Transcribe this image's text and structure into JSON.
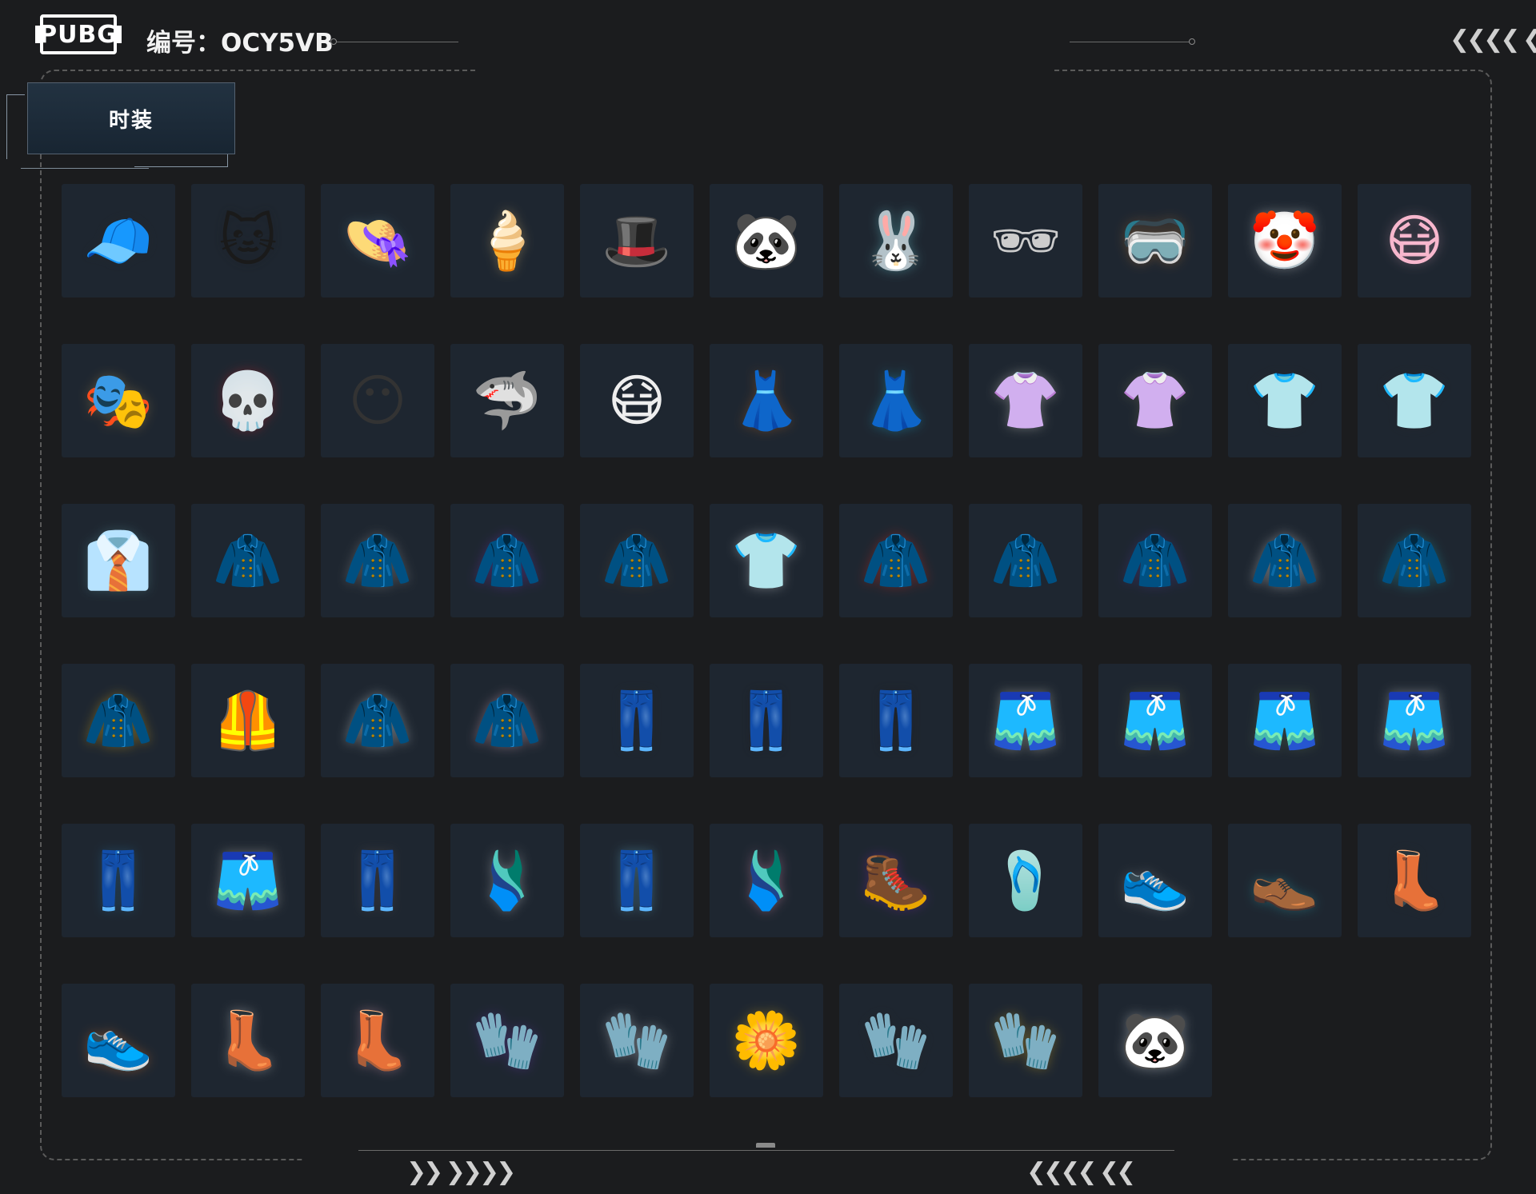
{
  "header": {
    "logo_text": "PUBG",
    "serial_label": "编号：",
    "serial_value": "OCY5VB",
    "chevrons_right": "❮❮❮❮ ❮"
  },
  "tab": {
    "label": "时装"
  },
  "footer": {
    "chevrons_left": "❯❯ ❯❯❯❯",
    "chevrons_right": "❮❮❮❮ ❮❮"
  },
  "items": [
    {
      "icon": "black-baseball-cap-icon",
      "glyph": "🧢",
      "color": "#2b2b2b"
    },
    {
      "icon": "black-cat-beanie-icon",
      "glyph": "🐱",
      "color": "#1a1a1a"
    },
    {
      "icon": "bucket-hat-icon",
      "glyph": "👒",
      "color": "#5a7f8f"
    },
    {
      "icon": "ice-cream-cone-hat-icon",
      "glyph": "🍦",
      "color": "#e8c17a"
    },
    {
      "icon": "black-wide-hat-icon",
      "glyph": "🎩",
      "color": "#222"
    },
    {
      "icon": "panda-headband-icon",
      "glyph": "🐼",
      "color": "#eee"
    },
    {
      "icon": "bunny-ears-headband-icon",
      "glyph": "🐰",
      "color": "#7fe0e6"
    },
    {
      "icon": "sunglasses-icon",
      "glyph": "🕶",
      "color": "#ccc"
    },
    {
      "icon": "orange-visor-icon",
      "glyph": "🥽",
      "color": "#c77d35"
    },
    {
      "icon": "clown-mask-goggles-icon",
      "glyph": "🤡",
      "color": "#eaeaea"
    },
    {
      "icon": "pink-face-mask-icon",
      "glyph": "😷",
      "color": "#f3b8cc"
    },
    {
      "icon": "gold-horned-mask-icon",
      "glyph": "🎭",
      "color": "#b99a55"
    },
    {
      "icon": "red-skull-mask-icon",
      "glyph": "💀",
      "color": "#c0282d"
    },
    {
      "icon": "black-tactical-mask-icon",
      "glyph": "😶",
      "color": "#333"
    },
    {
      "icon": "shark-teeth-mask-icon",
      "glyph": "🦈",
      "color": "#111"
    },
    {
      "icon": "white-face-mask-icon",
      "glyph": "😷",
      "color": "#eee"
    },
    {
      "icon": "orange-tie-dye-romper-icon",
      "glyph": "👗",
      "color": "#b46a2c"
    },
    {
      "icon": "blue-tie-dye-dress-icon",
      "glyph": "👗",
      "color": "#2ab3d6"
    },
    {
      "icon": "white-tie-front-shirt-icon",
      "glyph": "👚",
      "color": "#e9e6dc"
    },
    {
      "icon": "floral-tie-front-shirt-icon",
      "glyph": "👚",
      "color": "#7d7f5f"
    },
    {
      "icon": "black-long-sleeve-shirt-icon",
      "glyph": "👕",
      "color": "#2d2d2d"
    },
    {
      "icon": "black-chick-tshirt-icon",
      "glyph": "👕",
      "color": "#2d2d2d"
    },
    {
      "icon": "floral-hawaiian-shirt-icon",
      "glyph": "👔",
      "color": "#5c8f95"
    },
    {
      "icon": "black-cropped-jacket-icon",
      "glyph": "🧥",
      "color": "#333"
    },
    {
      "icon": "grey-orange-jacket-icon",
      "glyph": "🧥",
      "color": "#9a9a9a"
    },
    {
      "icon": "purple-cat-hoodie-icon",
      "glyph": "🧥",
      "color": "#6b3aa8"
    },
    {
      "icon": "leather-bomber-jacket-icon",
      "glyph": "🧥",
      "color": "#5a4a3c"
    },
    {
      "icon": "white-bunny-tshirt-icon",
      "glyph": "👕",
      "color": "#f4f4f4"
    },
    {
      "icon": "red-varsity-jacket-icon",
      "glyph": "🧥",
      "color": "#d63328"
    },
    {
      "icon": "white-hooded-jacket-icon",
      "glyph": "🧥",
      "color": "#eee"
    },
    {
      "icon": "purple-camo-jacket-icon",
      "glyph": "🧥",
      "color": "#4a3a8a"
    },
    {
      "icon": "white-orange-jacket-icon",
      "glyph": "🧥",
      "color": "#f0f0f0"
    },
    {
      "icon": "teal-gradient-hoodie-icon",
      "glyph": "🧥",
      "color": "#2aa5b0"
    },
    {
      "icon": "yellow-white-jacket-icon",
      "glyph": "🧥",
      "color": "#e6b82b"
    },
    {
      "icon": "black-bodysuit-icon",
      "glyph": "🦺",
      "color": "#222"
    },
    {
      "icon": "white-blue-hooded-coat-icon",
      "glyph": "🧥",
      "color": "#e8f0f4"
    },
    {
      "icon": "pink-white-hooded-jacket-icon",
      "glyph": "🧥",
      "color": "#f2c0d3"
    },
    {
      "icon": "black-leather-pants-icon",
      "glyph": "👖",
      "color": "#2a2a2a"
    },
    {
      "icon": "black-purple-pants-icon",
      "glyph": "👖",
      "color": "#1f1f1f"
    },
    {
      "icon": "black-gold-track-pants-icon",
      "glyph": "👖",
      "color": "#1f1f1f"
    },
    {
      "icon": "white-shorts-icon",
      "glyph": "🩳",
      "color": "#ebe6d6"
    },
    {
      "icon": "floral-shorts-icon",
      "glyph": "🩳",
      "color": "#7b7d5b"
    },
    {
      "icon": "green-denim-shorts-icon",
      "glyph": "🩳",
      "color": "#5f7457"
    },
    {
      "icon": "white-denim-shorts-icon",
      "glyph": "🩳",
      "color": "#e6e6e6"
    },
    {
      "icon": "blue-patched-jeans-icon",
      "glyph": "👖",
      "color": "#2f6f9a"
    },
    {
      "icon": "white-belted-shorts-icon",
      "glyph": "🩳",
      "color": "#d8d4cc"
    },
    {
      "icon": "camo-cargo-pants-icon",
      "glyph": "👖",
      "color": "#5a5050"
    },
    {
      "icon": "white-pleated-skirt-icon",
      "glyph": "🩱",
      "color": "#e8e8e8"
    },
    {
      "icon": "light-blue-cargo-pants-icon",
      "glyph": "👖",
      "color": "#6fb5cf"
    },
    {
      "icon": "pink-pleated-skirt-icon",
      "glyph": "🩱",
      "color": "#f2a0c2"
    },
    {
      "icon": "purple-boots-icon",
      "glyph": "🥾",
      "color": "#7a2fa8"
    },
    {
      "icon": "patterned-sandals-icon",
      "glyph": "🩴",
      "color": "#ccc"
    },
    {
      "icon": "grey-orange-sneakers-icon",
      "glyph": "👟",
      "color": "#8a8a8a"
    },
    {
      "icon": "teal-clogs-icon",
      "glyph": "👞",
      "color": "#38a9b2"
    },
    {
      "icon": "black-fur-boots-icon",
      "glyph": "👢",
      "color": "#2a2a2a"
    },
    {
      "icon": "orange-high-top-sneakers-icon",
      "glyph": "👟",
      "color": "#e27a34"
    },
    {
      "icon": "white-thigh-high-boots-icon",
      "glyph": "👢",
      "color": "#d8d8d8"
    },
    {
      "icon": "pink-fishnet-boots-icon",
      "glyph": "👢",
      "color": "#e3a6b7"
    },
    {
      "icon": "purple-black-gloves-icon",
      "glyph": "🧤",
      "color": "#6a3aa8"
    },
    {
      "icon": "white-teal-gloves-icon",
      "glyph": "🧤",
      "color": "#e8e8e8"
    },
    {
      "icon": "flower-bracelet-hand-icon",
      "glyph": "🌼",
      "color": "#e9b62e"
    },
    {
      "icon": "black-fingerless-gloves-icon",
      "glyph": "🧤",
      "color": "#2a2a2a"
    },
    {
      "icon": "yellow-black-gloves-icon",
      "glyph": "🧤",
      "color": "#d9b12f"
    },
    {
      "icon": "panda-gloves-icon",
      "glyph": "🐼",
      "color": "#f0f0f0"
    }
  ]
}
